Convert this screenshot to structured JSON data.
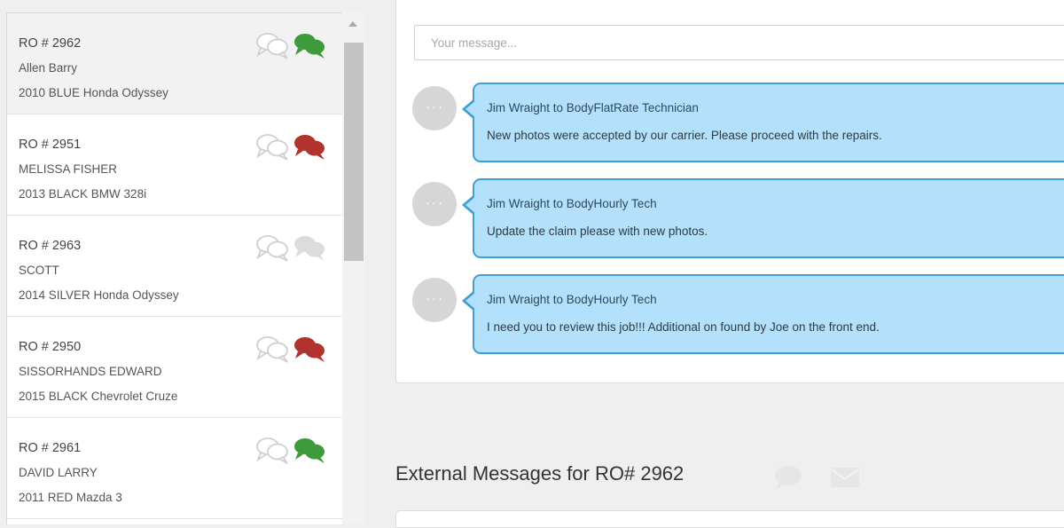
{
  "ro_list": [
    {
      "ro": "RO # 2962",
      "customer": "Allen Barry",
      "vehicle": "2010 BLUE Honda Odyssey",
      "status_color": "#3e9b3b",
      "selected": true
    },
    {
      "ro": "RO # 2951",
      "customer": "MELISSA FISHER",
      "vehicle": "2013 BLACK BMW 328i",
      "status_color": "#b3322e",
      "selected": false
    },
    {
      "ro": "RO # 2963",
      "customer": "SCOTT",
      "vehicle": "2014 SILVER Honda Odyssey",
      "status_color": "#dcdcdc",
      "selected": false
    },
    {
      "ro": "RO # 2950",
      "customer": "SISSORHANDS EDWARD",
      "vehicle": "2015 BLACK Chevrolet Cruze",
      "status_color": "#b3322e",
      "selected": false
    },
    {
      "ro": "RO # 2961",
      "customer": "DAVID LARRY",
      "vehicle": "2011 RED Mazda 3",
      "status_color": "#3e9b3b",
      "selected": false
    }
  ],
  "message_input": {
    "placeholder": "Your message..."
  },
  "messages": [
    {
      "from_to": "Jim Wraight to BodyFlatRate Technician",
      "text": "New photos were accepted by our carrier. Please proceed with the repairs."
    },
    {
      "from_to": "Jim Wraight to BodyHourly Tech",
      "text": "Update the claim please with new photos."
    },
    {
      "from_to": "Jim Wraight to  BodyHourly Tech",
      "text": "I need you to review this job!!! Additional on found by Joe on the front end."
    }
  ],
  "external": {
    "title": "External Messages for RO# 2962"
  },
  "icons": {
    "chat_outline": "chat-bubbles-outline-icon",
    "chat_filled": "chat-bubbles-filled-icon",
    "avatar": "avatar-placeholder",
    "ext_chat": "chat-icon",
    "ext_mail": "mail-icon"
  },
  "colors": {
    "bubble_fill": "#b3e0fb",
    "bubble_border": "#3c9fd6",
    "status_green": "#3e9b3b",
    "status_red": "#b3322e",
    "status_none": "#dcdcdc"
  }
}
